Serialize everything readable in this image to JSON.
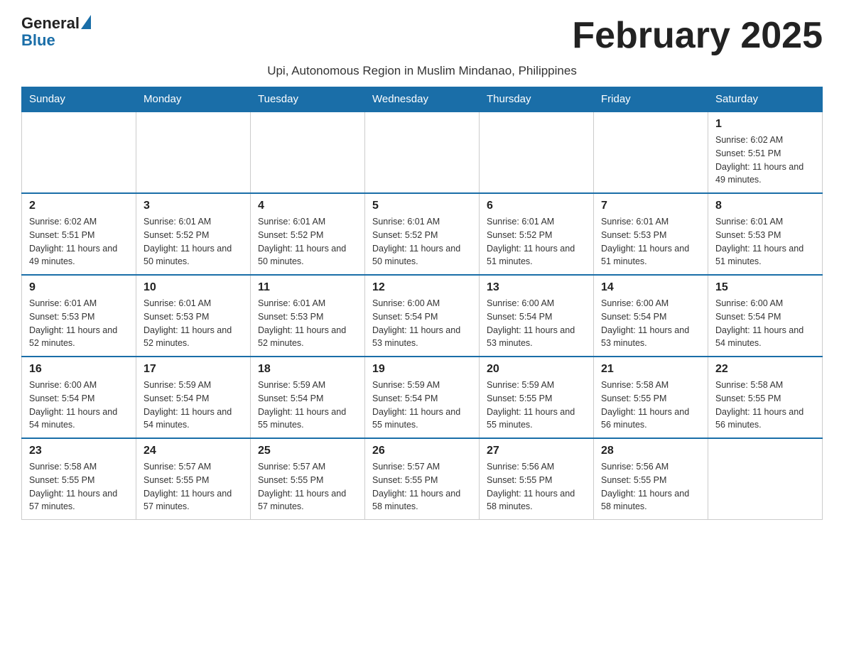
{
  "logo": {
    "general": "General",
    "blue": "Blue"
  },
  "title": "February 2025",
  "subtitle": "Upi, Autonomous Region in Muslim Mindanao, Philippines",
  "days_of_week": [
    "Sunday",
    "Monday",
    "Tuesday",
    "Wednesday",
    "Thursday",
    "Friday",
    "Saturday"
  ],
  "weeks": [
    [
      {
        "day": "",
        "info": ""
      },
      {
        "day": "",
        "info": ""
      },
      {
        "day": "",
        "info": ""
      },
      {
        "day": "",
        "info": ""
      },
      {
        "day": "",
        "info": ""
      },
      {
        "day": "",
        "info": ""
      },
      {
        "day": "1",
        "info": "Sunrise: 6:02 AM\nSunset: 5:51 PM\nDaylight: 11 hours and 49 minutes."
      }
    ],
    [
      {
        "day": "2",
        "info": "Sunrise: 6:02 AM\nSunset: 5:51 PM\nDaylight: 11 hours and 49 minutes."
      },
      {
        "day": "3",
        "info": "Sunrise: 6:01 AM\nSunset: 5:52 PM\nDaylight: 11 hours and 50 minutes."
      },
      {
        "day": "4",
        "info": "Sunrise: 6:01 AM\nSunset: 5:52 PM\nDaylight: 11 hours and 50 minutes."
      },
      {
        "day": "5",
        "info": "Sunrise: 6:01 AM\nSunset: 5:52 PM\nDaylight: 11 hours and 50 minutes."
      },
      {
        "day": "6",
        "info": "Sunrise: 6:01 AM\nSunset: 5:52 PM\nDaylight: 11 hours and 51 minutes."
      },
      {
        "day": "7",
        "info": "Sunrise: 6:01 AM\nSunset: 5:53 PM\nDaylight: 11 hours and 51 minutes."
      },
      {
        "day": "8",
        "info": "Sunrise: 6:01 AM\nSunset: 5:53 PM\nDaylight: 11 hours and 51 minutes."
      }
    ],
    [
      {
        "day": "9",
        "info": "Sunrise: 6:01 AM\nSunset: 5:53 PM\nDaylight: 11 hours and 52 minutes."
      },
      {
        "day": "10",
        "info": "Sunrise: 6:01 AM\nSunset: 5:53 PM\nDaylight: 11 hours and 52 minutes."
      },
      {
        "day": "11",
        "info": "Sunrise: 6:01 AM\nSunset: 5:53 PM\nDaylight: 11 hours and 52 minutes."
      },
      {
        "day": "12",
        "info": "Sunrise: 6:00 AM\nSunset: 5:54 PM\nDaylight: 11 hours and 53 minutes."
      },
      {
        "day": "13",
        "info": "Sunrise: 6:00 AM\nSunset: 5:54 PM\nDaylight: 11 hours and 53 minutes."
      },
      {
        "day": "14",
        "info": "Sunrise: 6:00 AM\nSunset: 5:54 PM\nDaylight: 11 hours and 53 minutes."
      },
      {
        "day": "15",
        "info": "Sunrise: 6:00 AM\nSunset: 5:54 PM\nDaylight: 11 hours and 54 minutes."
      }
    ],
    [
      {
        "day": "16",
        "info": "Sunrise: 6:00 AM\nSunset: 5:54 PM\nDaylight: 11 hours and 54 minutes."
      },
      {
        "day": "17",
        "info": "Sunrise: 5:59 AM\nSunset: 5:54 PM\nDaylight: 11 hours and 54 minutes."
      },
      {
        "day": "18",
        "info": "Sunrise: 5:59 AM\nSunset: 5:54 PM\nDaylight: 11 hours and 55 minutes."
      },
      {
        "day": "19",
        "info": "Sunrise: 5:59 AM\nSunset: 5:54 PM\nDaylight: 11 hours and 55 minutes."
      },
      {
        "day": "20",
        "info": "Sunrise: 5:59 AM\nSunset: 5:55 PM\nDaylight: 11 hours and 55 minutes."
      },
      {
        "day": "21",
        "info": "Sunrise: 5:58 AM\nSunset: 5:55 PM\nDaylight: 11 hours and 56 minutes."
      },
      {
        "day": "22",
        "info": "Sunrise: 5:58 AM\nSunset: 5:55 PM\nDaylight: 11 hours and 56 minutes."
      }
    ],
    [
      {
        "day": "23",
        "info": "Sunrise: 5:58 AM\nSunset: 5:55 PM\nDaylight: 11 hours and 57 minutes."
      },
      {
        "day": "24",
        "info": "Sunrise: 5:57 AM\nSunset: 5:55 PM\nDaylight: 11 hours and 57 minutes."
      },
      {
        "day": "25",
        "info": "Sunrise: 5:57 AM\nSunset: 5:55 PM\nDaylight: 11 hours and 57 minutes."
      },
      {
        "day": "26",
        "info": "Sunrise: 5:57 AM\nSunset: 5:55 PM\nDaylight: 11 hours and 58 minutes."
      },
      {
        "day": "27",
        "info": "Sunrise: 5:56 AM\nSunset: 5:55 PM\nDaylight: 11 hours and 58 minutes."
      },
      {
        "day": "28",
        "info": "Sunrise: 5:56 AM\nSunset: 5:55 PM\nDaylight: 11 hours and 58 minutes."
      },
      {
        "day": "",
        "info": ""
      }
    ]
  ]
}
